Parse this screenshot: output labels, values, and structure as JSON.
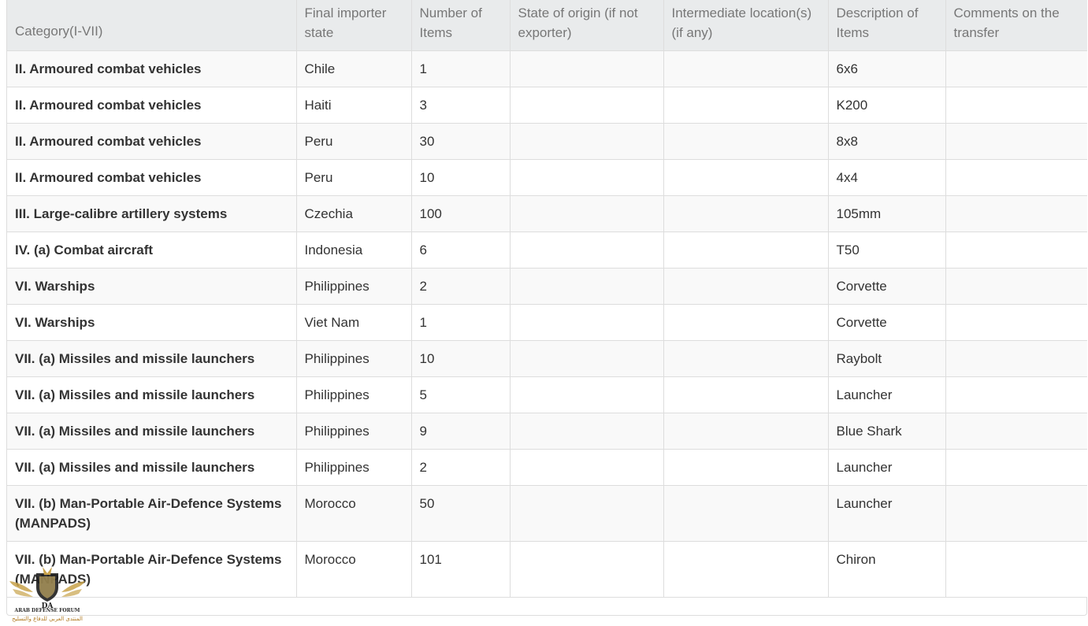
{
  "table": {
    "headers": [
      "Category(I-VII)",
      "Final importer state",
      "Number of Items",
      "State of origin (if not exporter)",
      "Intermediate location(s) (if any)",
      "Description of Items",
      "Comments on the transfer"
    ],
    "rows": [
      {
        "category": "II. Armoured combat vehicles",
        "importer": "Chile",
        "number": "1",
        "origin": "",
        "intermediate": "",
        "description": "6x6",
        "comments": ""
      },
      {
        "category": "II. Armoured combat vehicles",
        "importer": "Haiti",
        "number": "3",
        "origin": "",
        "intermediate": "",
        "description": "K200",
        "comments": ""
      },
      {
        "category": "II. Armoured combat vehicles",
        "importer": "Peru",
        "number": "30",
        "origin": "",
        "intermediate": "",
        "description": "8x8",
        "comments": ""
      },
      {
        "category": "II. Armoured combat vehicles",
        "importer": "Peru",
        "number": "10",
        "origin": "",
        "intermediate": "",
        "description": "4x4",
        "comments": ""
      },
      {
        "category": "III. Large-calibre artillery systems",
        "importer": "Czechia",
        "number": "100",
        "origin": "",
        "intermediate": "",
        "description": "105mm",
        "comments": ""
      },
      {
        "category": "IV. (a) Combat aircraft",
        "importer": "Indonesia",
        "number": "6",
        "origin": "",
        "intermediate": "",
        "description": "T50",
        "comments": ""
      },
      {
        "category": "VI. Warships",
        "importer": "Philippines",
        "number": "2",
        "origin": "",
        "intermediate": "",
        "description": "Corvette",
        "comments": ""
      },
      {
        "category": "VI. Warships",
        "importer": "Viet Nam",
        "number": "1",
        "origin": "",
        "intermediate": "",
        "description": "Corvette",
        "comments": ""
      },
      {
        "category": "VII. (a) Missiles and missile launchers",
        "importer": "Philippines",
        "number": "10",
        "origin": "",
        "intermediate": "",
        "description": "Raybolt",
        "comments": ""
      },
      {
        "category": "VII. (a) Missiles and missile launchers",
        "importer": "Philippines",
        "number": "5",
        "origin": "",
        "intermediate": "",
        "description": "Launcher",
        "comments": ""
      },
      {
        "category": "VII. (a) Missiles and missile launchers",
        "importer": "Philippines",
        "number": "9",
        "origin": "",
        "intermediate": "",
        "description": "Blue Shark",
        "comments": ""
      },
      {
        "category": "VII. (a) Missiles and missile launchers",
        "importer": "Philippines",
        "number": "2",
        "origin": "",
        "intermediate": "",
        "description": "Launcher",
        "comments": ""
      },
      {
        "category": "VII. (b) Man-Portable Air-Defence Systems (MANPADS)",
        "importer": "Morocco",
        "number": "50",
        "origin": "",
        "intermediate": "",
        "description": "Launcher",
        "comments": ""
      },
      {
        "category": "VII. (b) Man-Portable Air-Defence Systems (MANPADS)",
        "importer": "Morocco",
        "number": "101",
        "origin": "",
        "intermediate": "",
        "description": "Chiron",
        "comments": ""
      }
    ]
  },
  "watermark": {
    "text": "DA",
    "en": "ARAB DEFENSE FORUM",
    "ar": "المنتدى العربي للدفاع والتسليح"
  },
  "colors": {
    "header_bg": "#e9ebec",
    "stripe_bg": "#f9f9f9",
    "border": "#dddddd",
    "header_text": "#777777",
    "body_text": "#333333"
  }
}
